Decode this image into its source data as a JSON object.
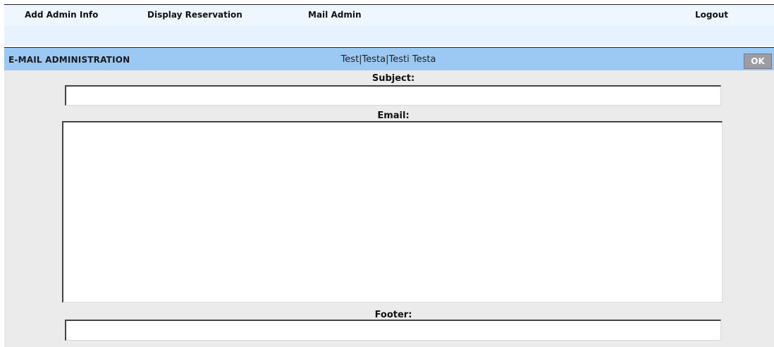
{
  "nav": {
    "add_admin_info": "Add Admin Info",
    "display_reservation": "Display Reservation",
    "mail_admin": "Mail Admin",
    "logout": "Logout"
  },
  "header": {
    "title": "E-MAIL ADMINISTRATION",
    "user": "Test|Testa|Testi Testa",
    "ok_label": "OK"
  },
  "form": {
    "subject_label": "Subject:",
    "subject_value": "",
    "email_label": "Email:",
    "email_value": "",
    "footer_label": "Footer:",
    "footer_value": ""
  }
}
